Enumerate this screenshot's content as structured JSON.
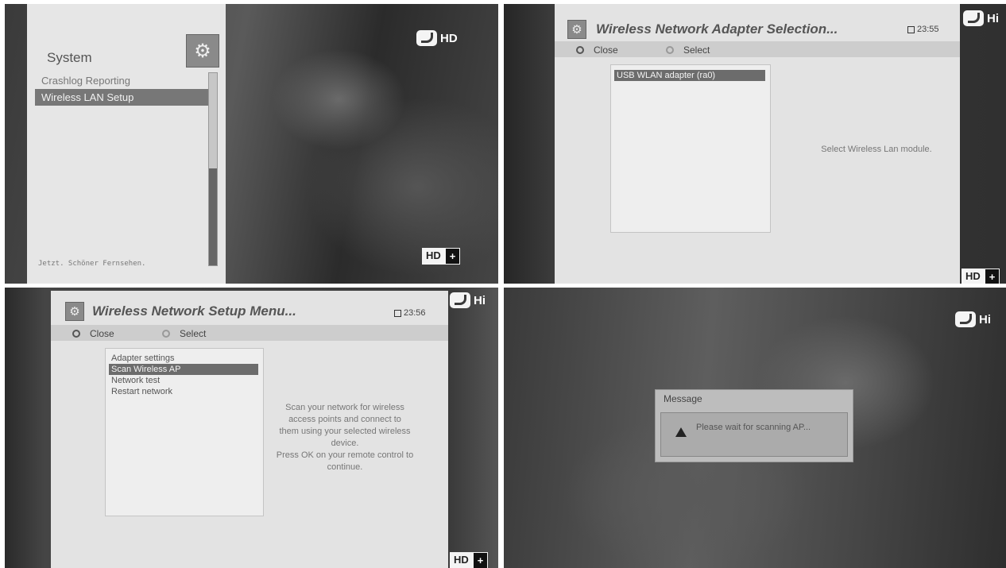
{
  "channel_logo_text": "HD",
  "hd_plus": {
    "hd": "HD",
    "plus": "+"
  },
  "panel1": {
    "title": "System",
    "items": [
      "Crashlog Reporting",
      "Wireless LAN Setup"
    ],
    "footer": "Jetzt. Schöner Fernsehen."
  },
  "panel2": {
    "title": "Wireless Network Adapter Selection...",
    "time": "23:55",
    "close_label": "Close",
    "select_label": "Select",
    "adapters": [
      "USB WLAN adapter (ra0)"
    ],
    "description": "Select Wireless Lan module."
  },
  "panel3": {
    "title": "Wireless Network Setup Menu...",
    "time": "23:56",
    "close_label": "Close",
    "select_label": "Select",
    "items": [
      "Adapter settings",
      "Scan Wireless AP",
      "Network test",
      "Restart network"
    ],
    "description_lines": [
      "Scan your network for wireless",
      "access points and connect to",
      "them using your selected wireless",
      "device.",
      "Press OK on your remote control to",
      "continue."
    ]
  },
  "panel4": {
    "message_title": "Message",
    "message_text": "Please wait for scanning AP..."
  },
  "colors": {
    "selection": "#6c6c6c",
    "dialog": "#e3e3e3",
    "button_bar": "#cdcdcd"
  }
}
